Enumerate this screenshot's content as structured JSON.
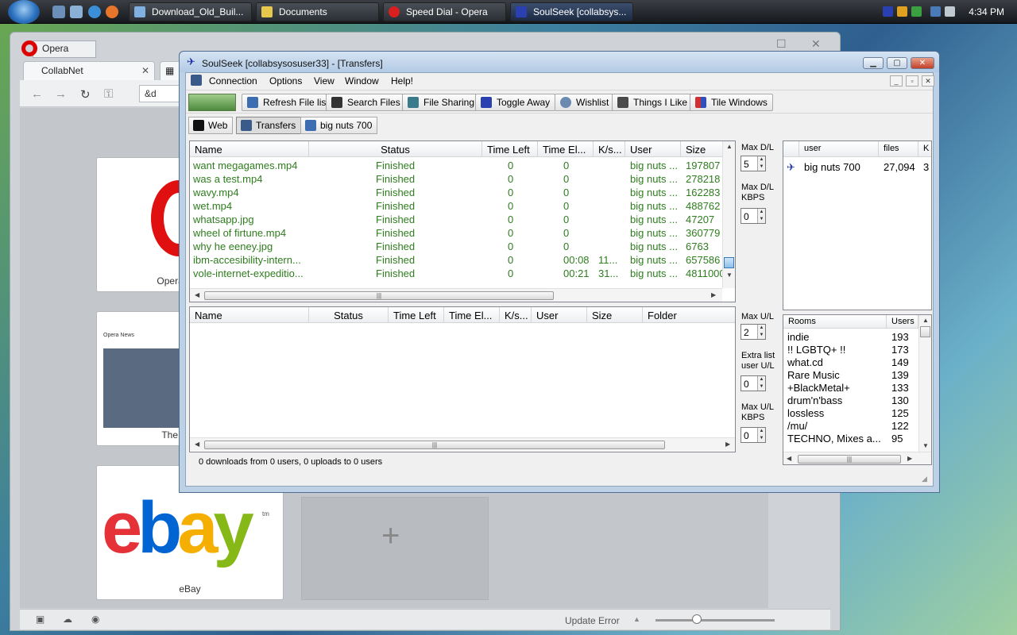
{
  "taskbar": {
    "buttons": [
      {
        "label": "Download_Old_Buil...",
        "icon_color": "#7fb0e0"
      },
      {
        "label": "Documents",
        "icon_color": "#e8c84a"
      },
      {
        "label": "Speed Dial - Opera",
        "icon_color": "#d92020"
      },
      {
        "label": "SoulSeek [collabsys...",
        "icon_color": "#2a3fb0"
      }
    ],
    "clock": "4:34 PM"
  },
  "opera": {
    "title": "Opera",
    "tab_label": "CollabNet",
    "url_text": "&d",
    "tiles": [
      {
        "label": "Opera Web Bro"
      },
      {
        "label": "The Opera Bl"
      },
      {
        "label": "eBay"
      }
    ],
    "ebay_letters": [
      "e",
      "b",
      "a",
      "y"
    ],
    "ebay_tm": "tm",
    "opera_news": "Opera News",
    "plus": "+",
    "status_text": "Update Error"
  },
  "ssk": {
    "title": "SoulSeek [collabsysosuser33] - [Transfers]",
    "menu": [
      "Connection",
      "Options",
      "View",
      "Window",
      "Help!"
    ],
    "toolbar": [
      "Refresh File list",
      "Search Files",
      "File Sharing",
      "Toggle Away",
      "Wishlist",
      "Things I Like",
      "Tile Windows"
    ],
    "tabs": [
      "Web",
      "Transfers",
      "big nuts 700"
    ],
    "downloads": {
      "columns": [
        "Name",
        "Status",
        "Time Left",
        "Time El...",
        "K/s...",
        "User",
        "Size"
      ],
      "rows": [
        [
          "want megagames.mp4",
          "Finished",
          "0",
          "0",
          "",
          "big nuts ...",
          "197807"
        ],
        [
          "was a test.mp4",
          "Finished",
          "0",
          "0",
          "",
          "big nuts ...",
          "278218"
        ],
        [
          "wavy.mp4",
          "Finished",
          "0",
          "0",
          "",
          "big nuts ...",
          "162283"
        ],
        [
          "wet.mp4",
          "Finished",
          "0",
          "0",
          "",
          "big nuts ...",
          "488762"
        ],
        [
          "whatsapp.jpg",
          "Finished",
          "0",
          "0",
          "",
          "big nuts ...",
          "47207"
        ],
        [
          "wheel of firtune.mp4",
          "Finished",
          "0",
          "0",
          "",
          "big nuts ...",
          "360779"
        ],
        [
          "why he eeney.jpg",
          "Finished",
          "0",
          "0",
          "",
          "big nuts ...",
          "6763"
        ],
        [
          "ibm-accesibility-intern...",
          "Finished",
          "0",
          "00:08",
          "11...",
          "big nuts ...",
          "657586"
        ],
        [
          "vole-internet-expeditio...",
          "Finished",
          "0",
          "00:21",
          "31...",
          "big nuts ...",
          "4811000"
        ]
      ]
    },
    "uploads": {
      "columns": [
        "Name",
        "Status",
        "Time Left",
        "Time El...",
        "K/s...",
        "User",
        "Size",
        "Folder"
      ]
    },
    "side_download": {
      "max_dl_label": "Max D/L",
      "max_dl_value": "5",
      "max_dl_kbps_label1": "Max D/L",
      "max_dl_kbps_label2": "KBPS",
      "max_dl_kbps_value": "0"
    },
    "side_upload": {
      "max_ul_label": "Max U/L",
      "max_ul_value": "2",
      "extra_label1": "Extra list",
      "extra_label2": "user U/L",
      "extra_value": "0",
      "max_ul_kbps_label1": "Max U/L",
      "max_ul_kbps_label2": "KBPS",
      "max_ul_kbps_value": "0"
    },
    "users_panel": {
      "columns": [
        "user",
        "files",
        "K"
      ],
      "rows": [
        [
          "big nuts 700",
          "27,094",
          "3"
        ]
      ]
    },
    "rooms_panel": {
      "columns": [
        "Rooms",
        "Users"
      ],
      "rows": [
        [
          "indie",
          "193"
        ],
        [
          "!! LGBTQ+ !!",
          "173"
        ],
        [
          "what.cd",
          "149"
        ],
        [
          "Rare Music",
          "139"
        ],
        [
          "+BlackMetal+",
          "133"
        ],
        [
          "drum'n'bass",
          "130"
        ],
        [
          "lossless",
          "125"
        ],
        [
          "/mu/",
          "122"
        ],
        [
          "TECHNO, Mixes a...",
          "95"
        ]
      ]
    },
    "status": "0 downloads from 0 users, 0 uploads to 0 users"
  }
}
